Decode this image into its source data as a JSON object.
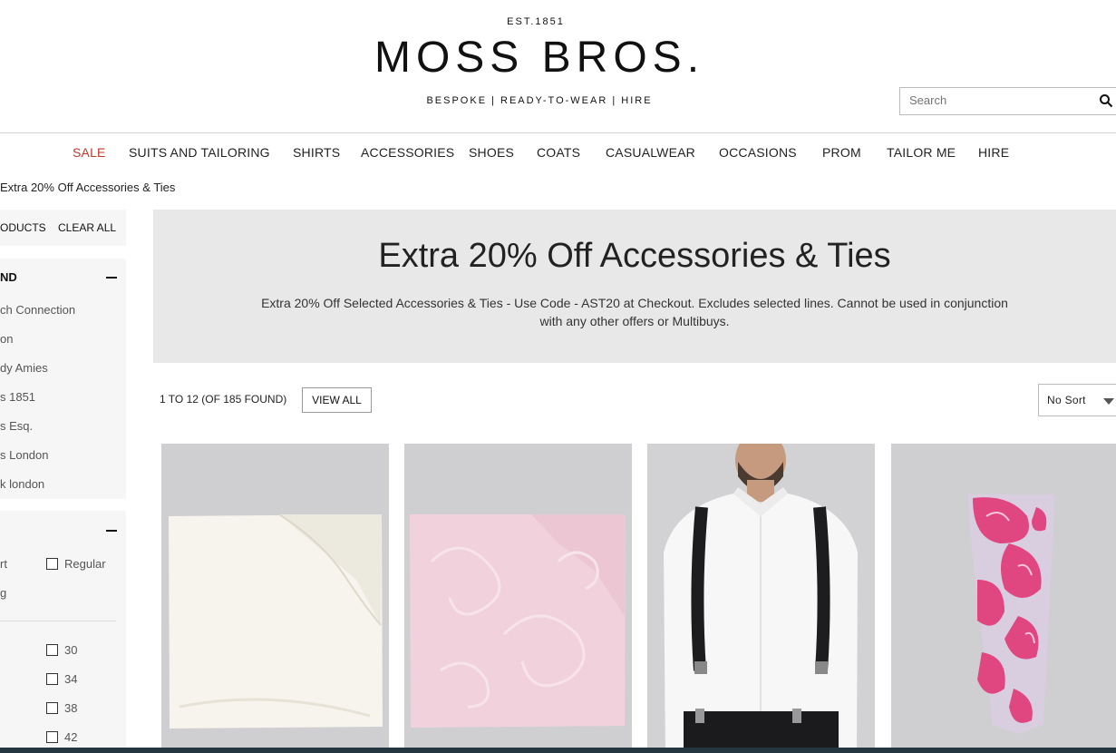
{
  "header": {
    "est": "EST.1851",
    "logo": "MOSS BROS.",
    "tagline": "BESPOKE | READY-TO-WEAR | HIRE"
  },
  "search": {
    "placeholder": "Search"
  },
  "nav": {
    "items": [
      {
        "label": "SALE"
      },
      {
        "label": "SUITS AND TAILORING"
      },
      {
        "label": "SHIRTS"
      },
      {
        "label": "ACCESSORIES"
      },
      {
        "label": "SHOES"
      },
      {
        "label": "COATS"
      },
      {
        "label": "CASUALWEAR"
      },
      {
        "label": "OCCASIONS"
      },
      {
        "label": "PROM"
      },
      {
        "label": "TAILOR ME"
      },
      {
        "label": "HIRE"
      }
    ]
  },
  "breadcrumb": "Extra 20% Off Accessories & Ties",
  "sidebar": {
    "products_label": "ODUCTS",
    "clear_all": "CLEAR ALL",
    "brand": {
      "title": "ND",
      "items": [
        "ch Connection",
        "on",
        "dy Amies",
        "s 1851",
        "s Esq.",
        "s London",
        "k london"
      ]
    },
    "fit": {
      "options_left": [
        "rt",
        "g"
      ],
      "option_regular": "Regular",
      "sizes": [
        "30",
        "34",
        "38",
        "42"
      ]
    }
  },
  "promo": {
    "title": "Extra 20% Off Accessories & Ties",
    "description": "Extra 20% Off Selected Accessories & Ties - Use Code - AST20 at Checkout. Excludes selected lines. Cannot be used in conjunction with any other offers or Multibuys."
  },
  "results": {
    "count": "1 TO 12 (OF 185 FOUND)",
    "view_all": "VIEW ALL",
    "sort": "No Sort"
  },
  "products": [
    {
      "image": "ivory-silk-pocket-square"
    },
    {
      "image": "pink-paisley-pocket-square"
    },
    {
      "image": "black-braces-model"
    },
    {
      "image": "pink-paisley-tie"
    }
  ],
  "colors": {
    "sale": "#c0392b",
    "promo_bg": "#e8e8e8",
    "panel_bg": "#f6f6f6",
    "card_bg": "#cfcfd1"
  }
}
